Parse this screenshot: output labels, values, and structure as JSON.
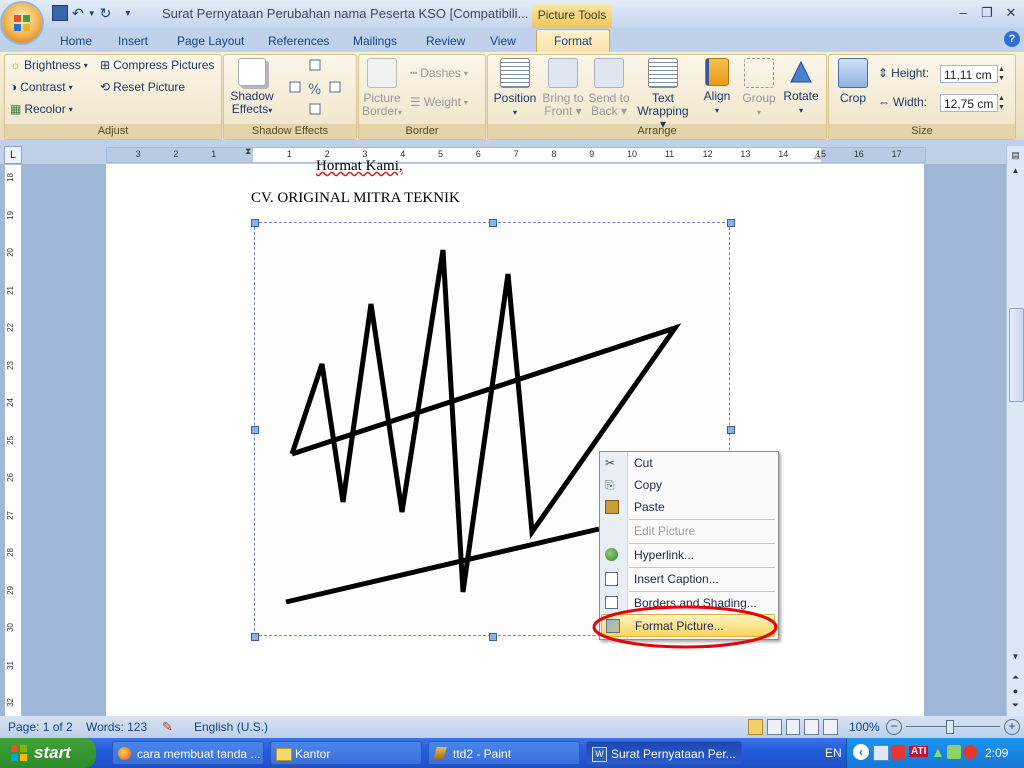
{
  "window": {
    "title": "Surat Pernyataan Perubahan nama Peserta KSO [Compatibili...",
    "contextual_tab_group": "Picture Tools"
  },
  "tabs": [
    "Home",
    "Insert",
    "Page Layout",
    "References",
    "Mailings",
    "Review",
    "View",
    "Format"
  ],
  "ribbon": {
    "adjust": {
      "label": "Adjust",
      "brightness": "Brightness",
      "contrast": "Contrast",
      "recolor": "Recolor",
      "compress": "Compress Pictures",
      "reset": "Reset Picture"
    },
    "shadow": {
      "label": "Shadow Effects",
      "button": "Shadow Effects"
    },
    "border": {
      "label": "Border",
      "picture_border": "Picture Border",
      "dashes": "Dashes",
      "weight": "Weight"
    },
    "arrange": {
      "label": "Arrange",
      "position": "Position",
      "bring": "Bring to Front",
      "send": "Send to Back",
      "wrap": "Text Wrapping",
      "align": "Align",
      "group": "Group",
      "rotate": "Rotate"
    },
    "size": {
      "label": "Size",
      "crop": "Crop",
      "height_label": "Height:",
      "height": "11,11 cm",
      "width_label": "Width:",
      "width": "12,75 cm"
    }
  },
  "ruler_numbers": [
    "3",
    "2",
    "1",
    "",
    "1",
    "2",
    "3",
    "4",
    "5",
    "6",
    "7",
    "8",
    "9",
    "10",
    "11",
    "12",
    "13",
    "14",
    "15",
    "16",
    "17"
  ],
  "vruler_numbers": [
    "18",
    "19",
    "20",
    "21",
    "22",
    "23",
    "24",
    "25",
    "26",
    "27",
    "28",
    "29",
    "30",
    "31",
    "32"
  ],
  "document": {
    "top_text": "Hormat Kami,",
    "company": "CV. ORIGINAL MITRA TEKNIK"
  },
  "context_menu": {
    "items": [
      {
        "label": "Cut",
        "icon": "scissors-icon",
        "enabled": true
      },
      {
        "label": "Copy",
        "icon": "copy-icon",
        "enabled": true
      },
      {
        "label": "Paste",
        "icon": "paste-icon",
        "enabled": true
      },
      {
        "label": "Edit Picture",
        "icon": "",
        "enabled": false
      },
      {
        "label": "Hyperlink...",
        "icon": "hyperlink-icon",
        "enabled": true
      },
      {
        "label": "Insert Caption...",
        "icon": "caption-icon",
        "enabled": true
      },
      {
        "label": "Borders and Shading...",
        "icon": "borders-icon",
        "enabled": true
      },
      {
        "label": "Format Picture...",
        "icon": "format-picture-icon",
        "enabled": true
      }
    ],
    "highlight_color": "#e8000a"
  },
  "statusbar": {
    "page": "Page: 1 of 2",
    "words": "Words: 123",
    "language": "English (U.S.)",
    "zoom": "100%"
  },
  "taskbar": {
    "start": "start",
    "tasks": [
      {
        "label": "cara membuat tanda ...",
        "icon": "firefox-icon"
      },
      {
        "label": "Kantor",
        "icon": "folder-icon"
      },
      {
        "label": "ttd2 - Paint",
        "icon": "paint-icon"
      },
      {
        "label": "Surat Pernyataan Per...",
        "icon": "word-icon"
      }
    ],
    "lang": "EN",
    "clock": "2:09"
  }
}
